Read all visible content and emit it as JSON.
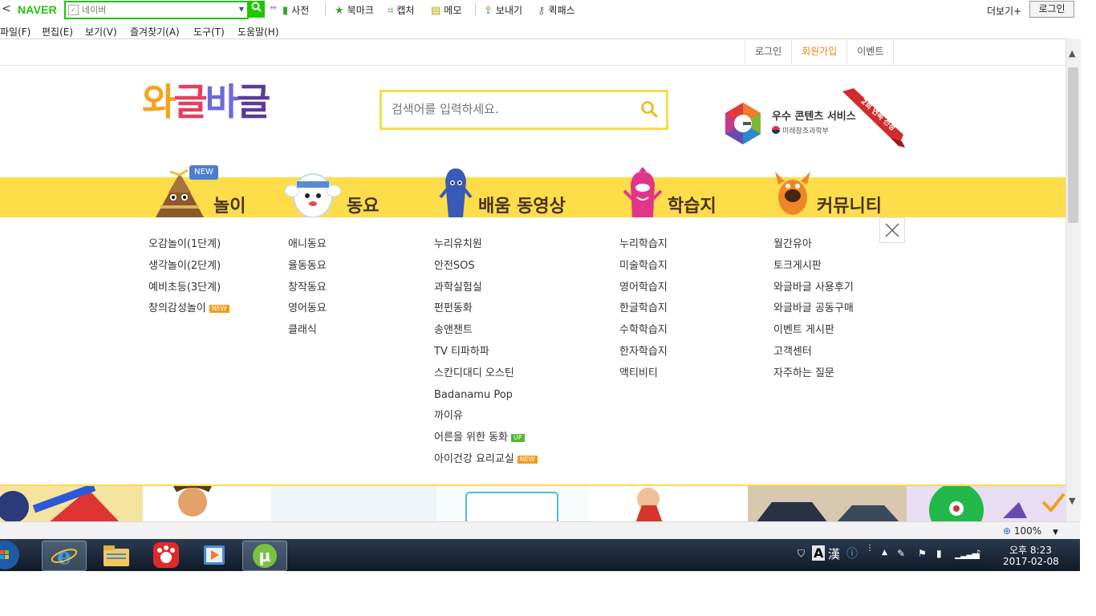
{
  "naver_toolbar": {
    "back_glyph": "<",
    "logo": "NAVER",
    "search_placeholder": "네이버",
    "items": [
      "사전",
      "북마크",
      "캡처",
      "메모",
      "보내기",
      "퀵패스"
    ],
    "more": "더보기+",
    "login": "로그인"
  },
  "menu_bar": [
    "파일(F)",
    "편집(E)",
    "보기(V)",
    "즐겨찾기(A)",
    "도구(T)",
    "도움말(H)"
  ],
  "top_links": [
    "로그인",
    "회원가입",
    "이벤트"
  ],
  "site": {
    "logo_chars": [
      "와",
      "글",
      "바",
      "글"
    ],
    "search_placeholder": "검색어를 입력하세요.",
    "badge_title": "우수 콘텐츠 서비스",
    "badge_sub": "미래창조과학부",
    "badge_ribbon": "2회 연속 선정"
  },
  "nav": {
    "new_tag": "NEW",
    "items": [
      "놀이",
      "동요",
      "배움 동영상",
      "학습지",
      "커뮤니티"
    ]
  },
  "columns": {
    "play": [
      "오감놀이(1단계)",
      "생각놀이(2단계)",
      "예비초등(3단계)",
      "창의감성놀이"
    ],
    "songs": [
      "애니동요",
      "율동동요",
      "창작동요",
      "영어동요",
      "클래식"
    ],
    "videos": [
      "누리유치원",
      "안전SOS",
      "과학실험실",
      "펀펀동화",
      "송앤챈트",
      "TV 티파하파",
      "스칸디대디 오스틴",
      "Badanamu Pop",
      "까이유",
      "어른을 위한 동화",
      "아이건강 요리교실"
    ],
    "worksheets": [
      "누리학습지",
      "미술학습지",
      "영어학습지",
      "한글학습지",
      "수학학습지",
      "한자학습지",
      "액티비티"
    ],
    "community": [
      "월간유아",
      "토크게시판",
      "와글바글 사용후기",
      "와글바글 공동구매",
      "이벤트 게시판",
      "고객센터",
      "자주하는 질문"
    ]
  },
  "tags": {
    "new": "NEW",
    "up": "UP"
  },
  "status": {
    "zoom": "100%"
  },
  "taskbar": {
    "ime_a": "A",
    "ime_han": "漢",
    "time": "오후 8:23",
    "date": "2017-02-08"
  },
  "colors": {
    "naver_green": "#1ec800",
    "band_yellow": "#fddd4a",
    "accent_orange": "#e48a0a"
  }
}
